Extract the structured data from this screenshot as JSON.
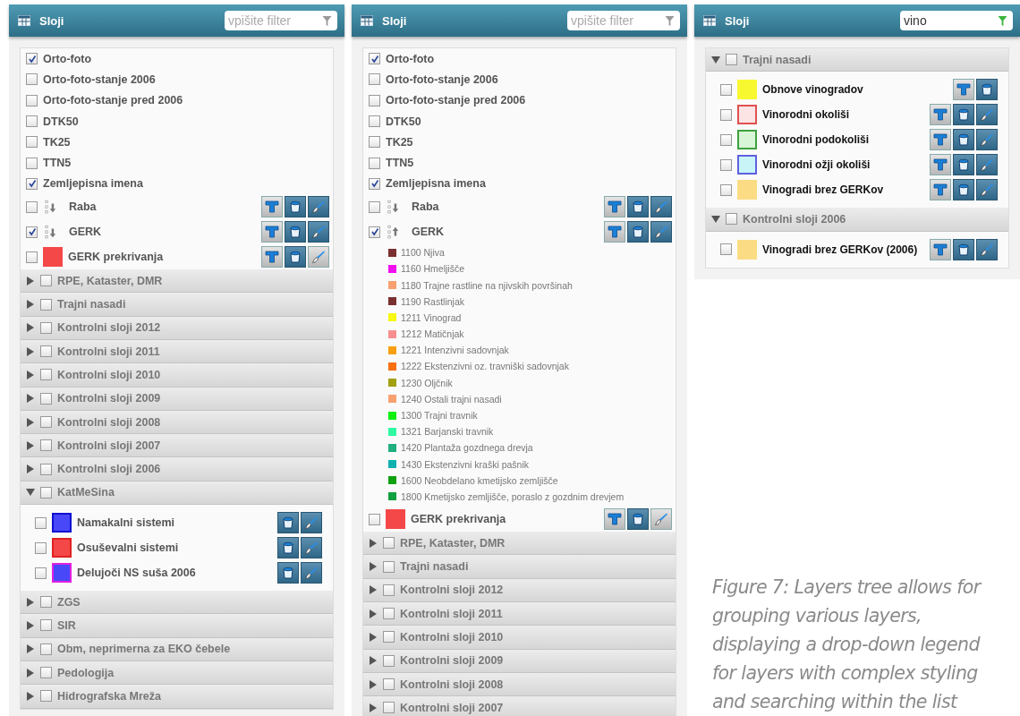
{
  "panels": [
    {
      "title": "Sloji",
      "filter": {
        "placeholder": "vpišite filter"
      },
      "items": [
        {
          "kind": "layer",
          "label": "Orto-foto",
          "checked": true
        },
        {
          "kind": "layer",
          "label": "Orto-foto-stanje 2006",
          "checked": false
        },
        {
          "kind": "layer",
          "label": "Orto-foto-stanje pred 2006",
          "checked": false
        },
        {
          "kind": "layer",
          "label": "DTK50",
          "checked": false
        },
        {
          "kind": "layer",
          "label": "TK25",
          "checked": false
        },
        {
          "kind": "layer",
          "label": "TTN5",
          "checked": false
        },
        {
          "kind": "layer",
          "label": "Zemljepisna imena",
          "checked": true
        },
        {
          "kind": "layer",
          "label": "Raba",
          "checked": false,
          "descending": true,
          "tools": [
            {
              "kind": "label",
              "on": false
            },
            {
              "kind": "fill",
              "on": true
            },
            {
              "kind": "brush",
              "on": true
            }
          ]
        },
        {
          "kind": "layer",
          "label": "GERK",
          "checked": true,
          "descending": true,
          "tools": [
            {
              "kind": "label",
              "on": false
            },
            {
              "kind": "fill",
              "on": true
            },
            {
              "kind": "brush",
              "on": true
            }
          ]
        },
        {
          "kind": "layer",
          "label": "GERK prekrivanja",
          "checked": false,
          "color": "#f44848",
          "tools": [
            {
              "kind": "label",
              "on": false
            },
            {
              "kind": "fill",
              "on": true
            },
            {
              "kind": "brush",
              "on": false
            }
          ]
        },
        {
          "kind": "group",
          "label": "RPE, Kataster, DMR",
          "checked": false,
          "expanded": false
        },
        {
          "kind": "group",
          "label": "Trajni nasadi",
          "checked": false,
          "expanded": false
        },
        {
          "kind": "group",
          "label": "Kontrolni sloji 2012",
          "checked": false,
          "expanded": false
        },
        {
          "kind": "group",
          "label": "Kontrolni sloji 2011",
          "checked": false,
          "expanded": false
        },
        {
          "kind": "group",
          "label": "Kontrolni sloji 2010",
          "checked": false,
          "expanded": false
        },
        {
          "kind": "group",
          "label": "Kontrolni sloji 2009",
          "checked": false,
          "expanded": false
        },
        {
          "kind": "group",
          "label": "Kontrolni sloji 2008",
          "checked": false,
          "expanded": false
        },
        {
          "kind": "group",
          "label": "Kontrolni sloji 2007",
          "checked": false,
          "expanded": false
        },
        {
          "kind": "group",
          "label": "Kontrolni sloji 2006",
          "checked": false,
          "expanded": false
        },
        {
          "kind": "group",
          "label": "KatMeSina",
          "checked": false,
          "expanded": true,
          "children": [
            {
              "kind": "layer",
              "label": "Namakalni sistemi",
              "checked": false,
              "color": "#4848f8",
              "outline": {
                "color": "#1010d0"
              },
              "tools": [
                {
                  "kind": "fill",
                  "on": true
                },
                {
                  "kind": "brush",
                  "on": true
                }
              ]
            },
            {
              "kind": "layer",
              "label": "Osuševalni sistemi",
              "checked": false,
              "color": "#f44848",
              "outline": {
                "color": "#e02020"
              },
              "tools": [
                {
                  "kind": "fill",
                  "on": true
                },
                {
                  "kind": "brush",
                  "on": true
                }
              ]
            },
            {
              "kind": "layer",
              "label": "Delujoči NS suša 2006",
              "checked": false,
              "color": "#4848f8",
              "outline": {
                "color": "#e020e0"
              },
              "tools": [
                {
                  "kind": "fill",
                  "on": true
                },
                {
                  "kind": "brush",
                  "on": true
                }
              ]
            }
          ]
        },
        {
          "kind": "group",
          "label": "ZGS",
          "checked": false,
          "expanded": false
        },
        {
          "kind": "group",
          "label": "SIR",
          "checked": false,
          "expanded": false
        },
        {
          "kind": "group",
          "label": "Obm, neprimerna za EKO čebele",
          "checked": false,
          "expanded": false
        },
        {
          "kind": "group",
          "label": "Pedologija",
          "checked": false,
          "expanded": false
        },
        {
          "kind": "group",
          "label": "Hidrografska Mreža",
          "checked": false,
          "expanded": false
        }
      ]
    },
    {
      "title": "Sloji",
      "filter": {
        "placeholder": "vpišite filter"
      },
      "items": [
        {
          "kind": "layer",
          "label": "Orto-foto",
          "checked": true
        },
        {
          "kind": "layer",
          "label": "Orto-foto-stanje 2006",
          "checked": false
        },
        {
          "kind": "layer",
          "label": "Orto-foto-stanje pred 2006",
          "checked": false
        },
        {
          "kind": "layer",
          "label": "DTK50",
          "checked": false
        },
        {
          "kind": "layer",
          "label": "TK25",
          "checked": false
        },
        {
          "kind": "layer",
          "label": "TTN5",
          "checked": false
        },
        {
          "kind": "layer",
          "label": "Zemljepisna imena",
          "checked": true
        },
        {
          "kind": "layer",
          "label": "Raba",
          "checked": false,
          "descending": true,
          "tools": [
            {
              "kind": "label",
              "on": false
            },
            {
              "kind": "fill",
              "on": true
            },
            {
              "kind": "brush",
              "on": true
            }
          ]
        },
        {
          "kind": "layer",
          "label": "GERK",
          "checked": true,
          "descending": false,
          "tools": [
            {
              "kind": "label",
              "on": false
            },
            {
              "kind": "fill",
              "on": true
            },
            {
              "kind": "brush",
              "on": true
            }
          ],
          "legend": [
            {
              "text": "1100 Njiva",
              "color": "#7a3030"
            },
            {
              "text": "1160 Hmeljišče",
              "color": "#f010f0"
            },
            {
              "text": "1180 Trajne rastline na njivskih površinah",
              "color": "#f8a070"
            },
            {
              "text": "1190 Rastlinjak",
              "color": "#7a3030"
            },
            {
              "text": "1211 Vinograd",
              "color": "#f8f810"
            },
            {
              "text": "1212 Matičnjak",
              "color": "#f89090"
            },
            {
              "text": "1221 Intenzivni sadovnjak",
              "color": "#f8a010"
            },
            {
              "text": "1222 Ekstenzivni oz. travniški sadovnjak",
              "color": "#f87010"
            },
            {
              "text": "1230 Oljčnik",
              "color": "#a0a010"
            },
            {
              "text": "1240 Ostali trajni nasadi",
              "color": "#f8a070"
            },
            {
              "text": "1300 Trajni travnik",
              "color": "#10f010"
            },
            {
              "text": "1321 Barjanski travnik",
              "color": "#30f8a0"
            },
            {
              "text": "1420 Plantaža gozdnega drevja",
              "color": "#20b080"
            },
            {
              "text": "1430 Ekstenzivni kraški pašnik",
              "color": "#10b0b0"
            },
            {
              "text": "1600 Neobdelano kmetijsko zemljišče",
              "color": "#10a010"
            },
            {
              "text": "1800 Kmetijsko zemljišče, poraslo z gozdnim drevjem",
              "color": "#10a040"
            }
          ]
        },
        {
          "kind": "layer",
          "label": "GERK prekrivanja",
          "checked": false,
          "color": "#f44848",
          "tools": [
            {
              "kind": "label",
              "on": false
            },
            {
              "kind": "fill",
              "on": true
            },
            {
              "kind": "brush",
              "on": false
            }
          ]
        },
        {
          "kind": "group",
          "label": "RPE, Kataster, DMR",
          "checked": false,
          "expanded": false
        },
        {
          "kind": "group",
          "label": "Trajni nasadi",
          "checked": false,
          "expanded": false
        },
        {
          "kind": "group",
          "label": "Kontrolni sloji 2012",
          "checked": false,
          "expanded": false
        },
        {
          "kind": "group",
          "label": "Kontrolni sloji 2011",
          "checked": false,
          "expanded": false
        },
        {
          "kind": "group",
          "label": "Kontrolni sloji 2010",
          "checked": false,
          "expanded": false
        },
        {
          "kind": "group",
          "label": "Kontrolni sloji 2009",
          "checked": false,
          "expanded": false
        },
        {
          "kind": "group",
          "label": "Kontrolni sloji 2008",
          "checked": false,
          "expanded": false
        },
        {
          "kind": "group",
          "label": "Kontrolni sloji 2007",
          "checked": false,
          "expanded": false
        }
      ]
    },
    {
      "title": "Sloji",
      "filter": {
        "value": "vino"
      },
      "items": [
        {
          "kind": "group",
          "label": "Trajni nasadi",
          "checked": false,
          "expanded": true,
          "children": [
            {
              "kind": "layer",
              "label": "Obnove vinogradov",
              "checked": false,
              "color": "#f8f830",
              "tools": [
                {
                  "kind": "label",
                  "on": false
                },
                {
                  "kind": "fill",
                  "on": true
                }
              ]
            },
            {
              "kind": "layer",
              "label": "Vinorodni okoliši",
              "checked": false,
              "color": "#fde4e4",
              "outline": {
                "color": "#e05050"
              },
              "tools": [
                {
                  "kind": "label",
                  "on": false
                },
                {
                  "kind": "fill",
                  "on": true
                },
                {
                  "kind": "brush",
                  "on": true
                }
              ]
            },
            {
              "kind": "layer",
              "label": "Vinorodni podokoliši",
              "checked": false,
              "color": "#d8f5d8",
              "outline": {
                "color": "#40a040"
              },
              "tools": [
                {
                  "kind": "label",
                  "on": false
                },
                {
                  "kind": "fill",
                  "on": true
                },
                {
                  "kind": "brush",
                  "on": true
                }
              ]
            },
            {
              "kind": "layer",
              "label": "Vinorodni ožji okoliši",
              "checked": false,
              "color": "#c8f4f8",
              "outline": {
                "color": "#6060e0"
              },
              "tools": [
                {
                  "kind": "label",
                  "on": false
                },
                {
                  "kind": "fill",
                  "on": true
                },
                {
                  "kind": "brush",
                  "on": true
                }
              ]
            },
            {
              "kind": "layer",
              "label": "Vinogradi brez GERKov",
              "checked": false,
              "color": "#fbdc84",
              "tools": [
                {
                  "kind": "label",
                  "on": false
                },
                {
                  "kind": "fill",
                  "on": true
                },
                {
                  "kind": "brush",
                  "on": true
                }
              ]
            }
          ]
        },
        {
          "kind": "group",
          "label": "Kontrolni sloji 2006",
          "checked": false,
          "expanded": true,
          "children": [
            {
              "kind": "layer",
              "label": "Vinogradi brez GERKov (2006)",
              "checked": false,
              "color": "#fbdc84",
              "tools": [
                {
                  "kind": "label",
                  "on": false
                },
                {
                  "kind": "fill",
                  "on": true
                },
                {
                  "kind": "brush",
                  "on": true
                }
              ]
            }
          ]
        }
      ]
    }
  ],
  "caption": "Figure 7: Layers tree allows for grouping various layers, displaying a drop-down legend for layers with complex styling and searching within the list"
}
